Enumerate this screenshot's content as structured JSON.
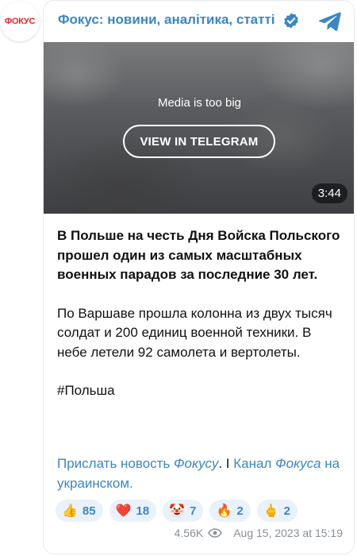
{
  "channel": {
    "avatar_text": "ФОКУС",
    "title": "Фокус: новини, аналітика, статті"
  },
  "media": {
    "note": "Media is too big",
    "button_label": "VIEW IN TELEGRAM",
    "duration": "3:44"
  },
  "post": {
    "lead": "В Польше на честь Дня Войска Польского прошел один из самых масштабных военных парадов за последние 30 лет.",
    "paragraph": "По Варшаве прошла колонна из двух тысяч солдат и 200 единиц военной техники. В небе летели 92 самолета и вертолеты.",
    "hashtag": "#Польша"
  },
  "links": {
    "send_news_prefix": "Прислать новость ",
    "send_news_italic": "Фокусу",
    "separator": ". I ",
    "channel_prefix": "Канал ",
    "channel_italic": "Фокуса",
    "channel_suffix": " на украинском."
  },
  "reactions": [
    {
      "emoji": "👍",
      "count": "85",
      "icon": "thumbs-up-icon"
    },
    {
      "emoji": "❤️",
      "count": "18",
      "icon": "heart-icon"
    },
    {
      "emoji": "🤡",
      "count": "7",
      "icon": "clown-icon"
    },
    {
      "emoji": "🔥",
      "count": "2",
      "icon": "fire-icon"
    },
    {
      "emoji": "🖕",
      "count": "2",
      "icon": "middle-finger-icon"
    }
  ],
  "footer": {
    "views": "4.56K",
    "date": "Aug 15, 2023 at 15:19"
  },
  "colors": {
    "link": "#3a87c4",
    "brand_red": "#e3262c",
    "reaction_bg": "#e9f2fb"
  }
}
